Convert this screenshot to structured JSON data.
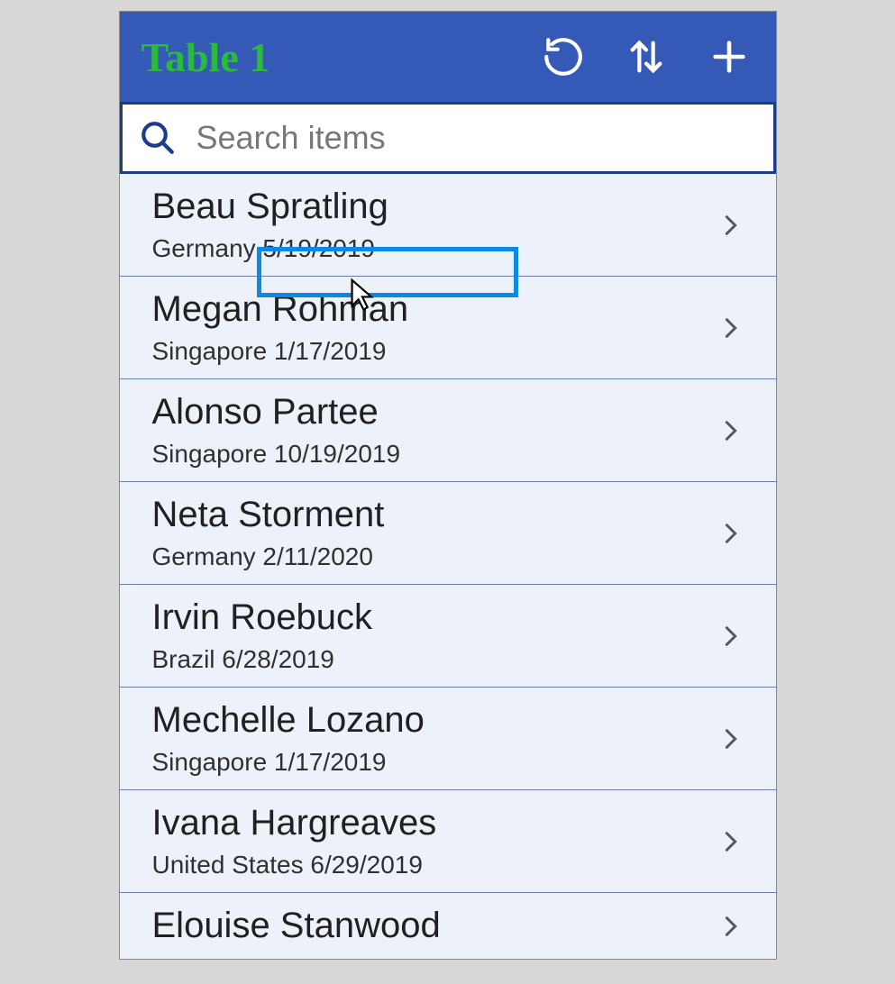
{
  "header": {
    "title": "Table 1"
  },
  "search": {
    "placeholder": "Search items"
  },
  "items": [
    {
      "name": "Beau Spratling",
      "sub": "Germany 5/19/2019"
    },
    {
      "name": "Megan Rohman",
      "sub": "Singapore 1/17/2019"
    },
    {
      "name": "Alonso Partee",
      "sub": "Singapore 10/19/2019"
    },
    {
      "name": "Neta Storment",
      "sub": "Germany 2/11/2020"
    },
    {
      "name": "Irvin Roebuck",
      "sub": "Brazil 6/28/2019"
    },
    {
      "name": "Mechelle Lozano",
      "sub": "Singapore 1/17/2019"
    },
    {
      "name": "Ivana Hargreaves",
      "sub": "United States 6/29/2019"
    },
    {
      "name": "Elouise Stanwood",
      "sub": ""
    }
  ]
}
